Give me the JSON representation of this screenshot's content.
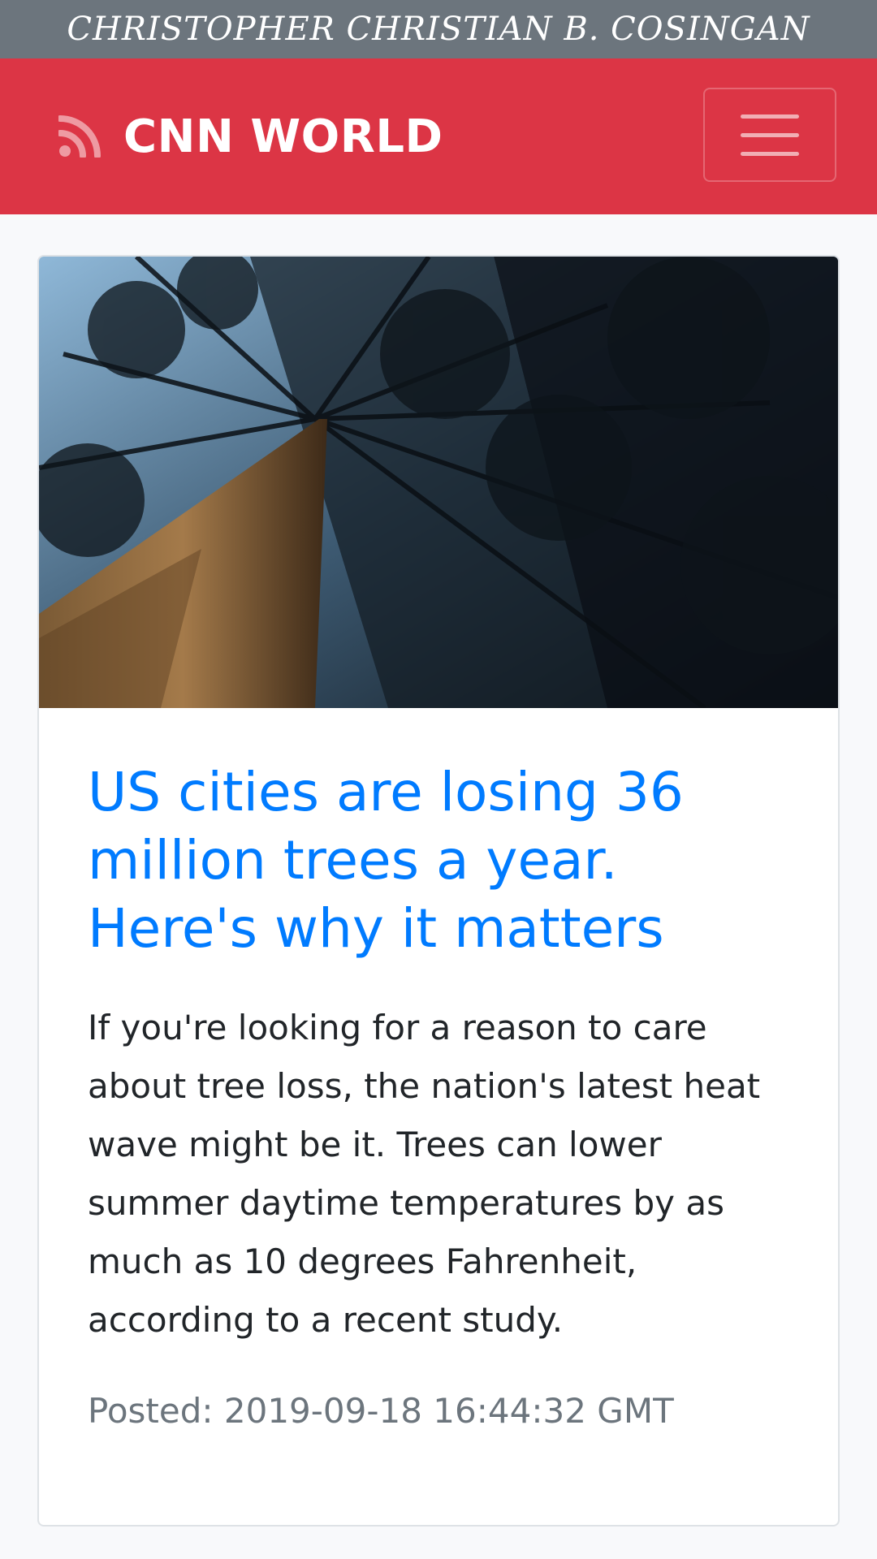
{
  "author_bar": {
    "text": "CHRISTOPHER CHRISTIAN B. COSINGAN"
  },
  "navbar": {
    "brand_icon": "rss-icon",
    "brand_text": "CNN WORLD",
    "toggler_icon": "hamburger-menu-icon"
  },
  "article": {
    "image_alt": "Looking up at tall pine tree trunks and canopy against the sky",
    "title": "US cities are losing 36 million trees a year. Here's why it matters",
    "description": "If you're looking for a reason to care about tree loss, the nation's latest heat wave might be it. Trees can lower summer daytime temperatures by as much as 10 degrees Fahrenheit, according to a recent study.",
    "posted": "Posted: 2019-09-18 16:44:32 GMT"
  },
  "colors": {
    "navbar_bg": "#dc3545",
    "author_bar_bg": "#6c757d",
    "title_link": "#007bff",
    "muted_text": "#6c757d"
  }
}
